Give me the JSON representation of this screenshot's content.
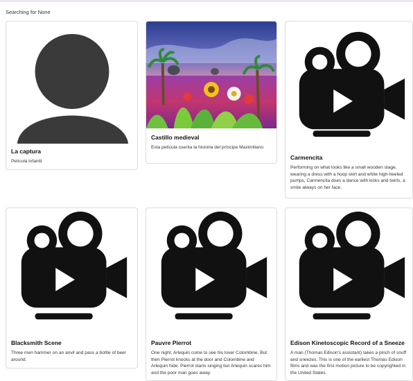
{
  "search": {
    "status_text": "Searching for None"
  },
  "colors": {
    "placeholder_gray": "#3a3a3b",
    "icon_black": "#111111",
    "card_border": "#dcdcdc"
  },
  "cards": [
    {
      "title": "La captura",
      "description": "Película infantil",
      "image": "person-placeholder-icon"
    },
    {
      "title": "Castillo medieval",
      "description": "Esta película cuenta la historia del príncipe Maximiliano",
      "image": "fantasy-landscape-photo"
    },
    {
      "title": "Carmencita",
      "description": "Performing on what looks like a small wooden stage, wearing a dress with a hoop skirt and white high-heeled pumps, Carmencita does a dance with kicks and twirls, a smile always on her face.",
      "image": "movie-camera-icon"
    },
    {
      "title": "Blacksmith Scene",
      "description": "Three men hammer on an anvil and pass a bottle of beer around.",
      "image": "movie-camera-icon"
    },
    {
      "title": "Pauvre Pierrot",
      "description": "One night, Arlequin come to see his lover Colombine. But then Pierrot knocks at the door and Colombine and Arlequin hide. Pierrot starts singing but Arlequin scares him and the poor man goes away.",
      "image": "movie-camera-icon"
    },
    {
      "title": "Edison Kinetoscopic Record of a Sneeze",
      "description": "A man (Thomas Edison's assistant) takes a pinch of snuff and sneezes. This is one of the earliest Thomas Edison films and was the first motion picture to be copyrighted in the United States.",
      "image": "movie-camera-icon"
    }
  ]
}
